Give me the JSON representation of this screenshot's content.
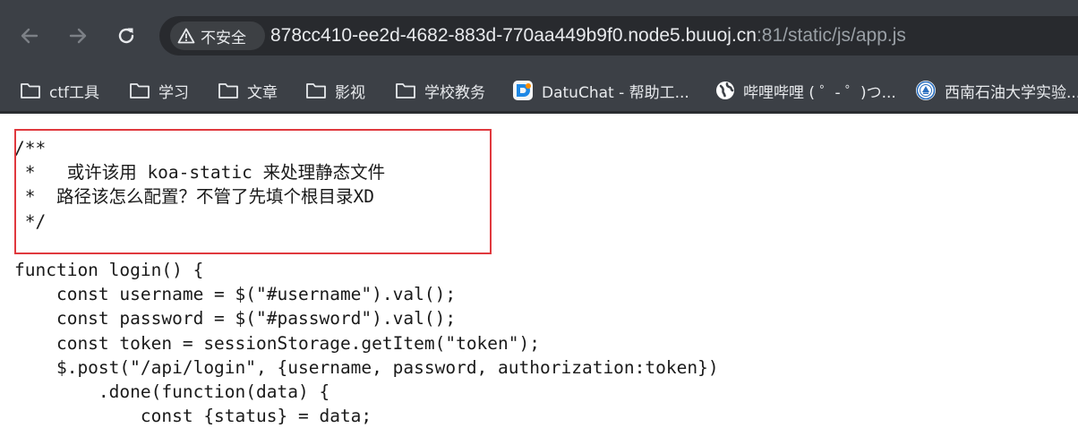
{
  "browser": {
    "address_bar": {
      "security_label": "不安全",
      "url_host": "878cc410-ee2d-4682-883d-770aa449b9f0.node5.buuoj.cn",
      "url_rest": ":81/static/js/app.js"
    },
    "bookmarks": [
      {
        "label": "ctf工具",
        "icon": "folder-icon"
      },
      {
        "label": "学习",
        "icon": "folder-icon"
      },
      {
        "label": "文章",
        "icon": "folder-icon"
      },
      {
        "label": "影视",
        "icon": "folder-icon"
      },
      {
        "label": "学校教务",
        "icon": "folder-icon"
      },
      {
        "label": "DatuChat - 帮助工...",
        "icon": "datuchat-icon"
      },
      {
        "label": "哔哩哔哩 ( ゜- ゜)つ...",
        "icon": "globe-icon"
      },
      {
        "label": "西南石油大学实验...",
        "icon": "university-logo-icon"
      }
    ]
  },
  "page": {
    "code_lines": [
      "/**",
      " *   或许该用 koa-static 来处理静态文件",
      " *  路径该怎么配置？不管了先填个根目录XD",
      " */",
      "",
      "function login() {",
      "    const username = $(\"#username\").val();",
      "    const password = $(\"#password\").val();",
      "    const token = sessionStorage.getItem(\"token\");",
      "    $.post(\"/api/login\", {username, password, authorization:token})",
      "        .done(function(data) {",
      "            const {status} = data;"
    ]
  },
  "colors": {
    "toolbar_bg": "#3c4046",
    "address_bg": "#282a2e",
    "highlight_border": "#e0393e",
    "text_light": "#e8eaed"
  }
}
